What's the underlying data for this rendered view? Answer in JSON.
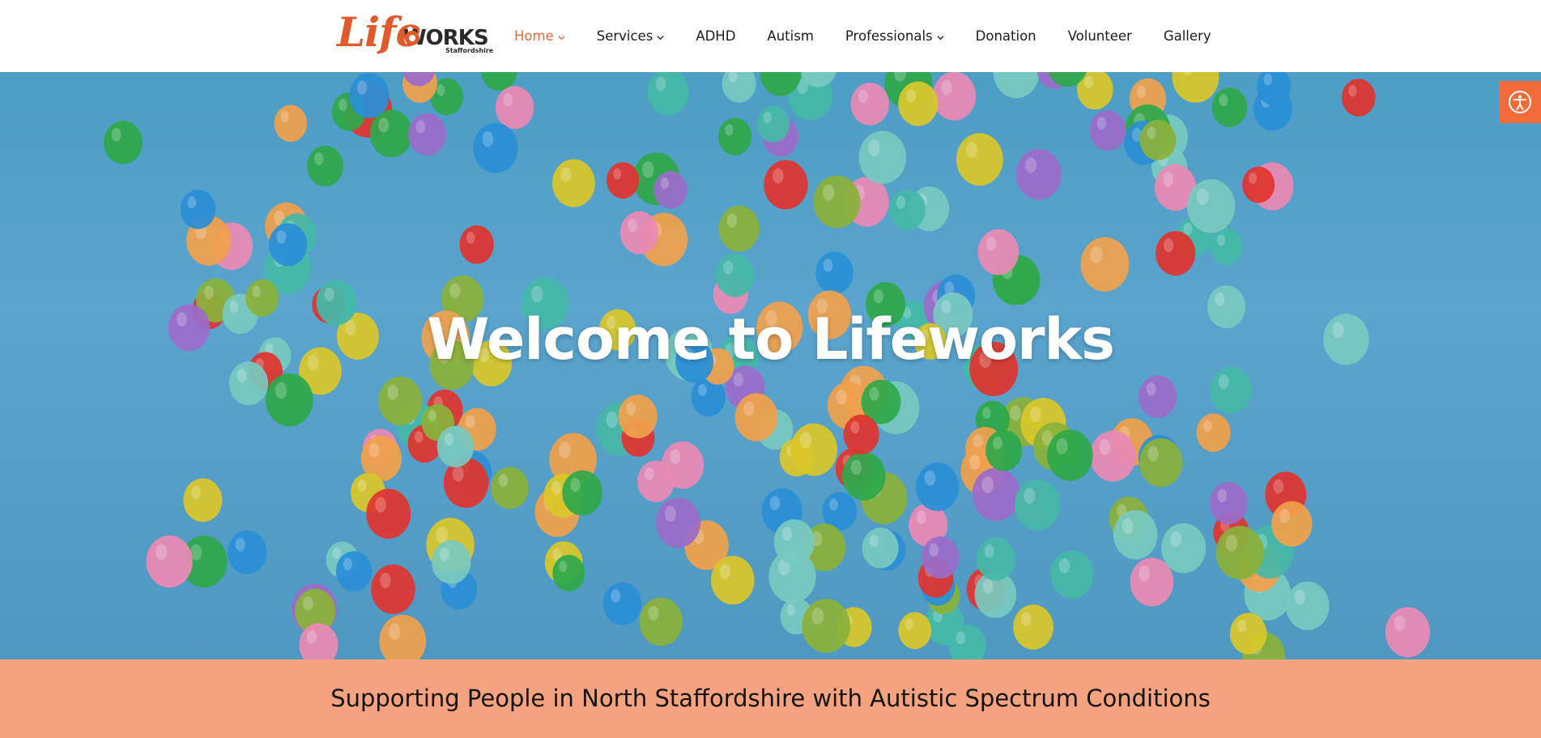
{
  "brand": {
    "logo_script": "Life",
    "logo_word": "WORKS",
    "logo_sub": "Staffordshire",
    "accent": "#e8673a"
  },
  "nav": {
    "items": [
      {
        "label": "Home",
        "has_dropdown": true,
        "active": true
      },
      {
        "label": "Services",
        "has_dropdown": true,
        "active": false
      },
      {
        "label": "ADHD",
        "has_dropdown": false,
        "active": false
      },
      {
        "label": "Autism",
        "has_dropdown": false,
        "active": false
      },
      {
        "label": "Professionals",
        "has_dropdown": true,
        "active": false
      },
      {
        "label": "Donation",
        "has_dropdown": false,
        "active": false
      },
      {
        "label": "Volunteer",
        "has_dropdown": false,
        "active": false
      },
      {
        "label": "Gallery",
        "has_dropdown": false,
        "active": false
      }
    ]
  },
  "hero": {
    "title": "Welcome to Lifeworks",
    "background_icon": "balloons-sky-image"
  },
  "accessibility": {
    "icon": "accessibility-icon",
    "color": "#f26b3a"
  },
  "banner": {
    "text": "Supporting People in North Staffordshire with Autistic Spectrum Conditions",
    "color": "#f4a27f"
  }
}
